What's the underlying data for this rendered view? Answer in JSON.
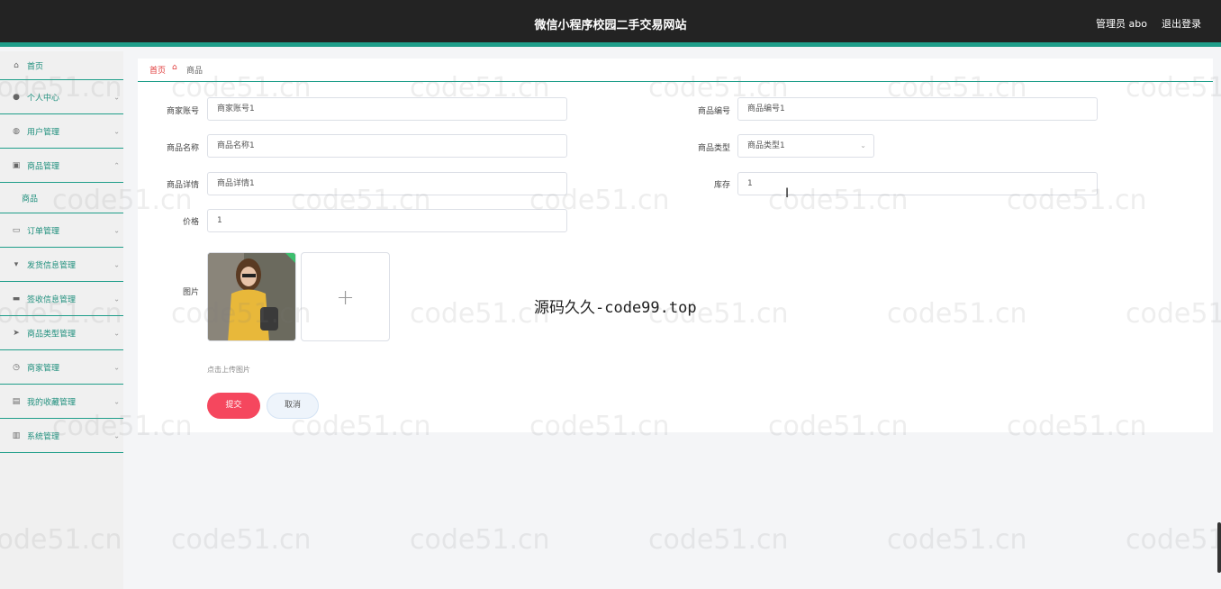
{
  "header": {
    "title": "微信小程序校园二手交易网站",
    "user": "管理员 abo",
    "logout": "退出登录"
  },
  "sidebar": {
    "items": [
      {
        "label": "首页",
        "icon": "home-icon",
        "glyph": "⌂"
      },
      {
        "label": "个人中心",
        "icon": "user-icon",
        "glyph": "●"
      },
      {
        "label": "用户管理",
        "icon": "users-icon",
        "glyph": "◍"
      },
      {
        "label": "商品管理",
        "icon": "goods-icon",
        "glyph": "▣"
      },
      {
        "label": "订单管理",
        "icon": "order-icon",
        "glyph": "▭"
      },
      {
        "label": "发货信息管理",
        "icon": "shipping-icon",
        "glyph": "▾"
      },
      {
        "label": "签收信息管理",
        "icon": "sign-icon",
        "glyph": "▬"
      },
      {
        "label": "商品类型管理",
        "icon": "send-icon",
        "glyph": "➤"
      },
      {
        "label": "商家管理",
        "icon": "clock-icon",
        "glyph": "◷"
      },
      {
        "label": "我的收藏管理",
        "icon": "favorite-icon",
        "glyph": "▤"
      },
      {
        "label": "系统管理",
        "icon": "system-icon",
        "glyph": "▥"
      }
    ],
    "submenu_goods": "商品"
  },
  "breadcrumb": {
    "home": "首页",
    "current": "商品"
  },
  "form": {
    "merchant_account": {
      "label": "商家账号",
      "value": "商家账号1"
    },
    "goods_no": {
      "label": "商品编号",
      "value": "商品编号1"
    },
    "goods_name": {
      "label": "商品名称",
      "value": "商品名称1"
    },
    "goods_type": {
      "label": "商品类型",
      "value": "商品类型1"
    },
    "goods_detail": {
      "label": "商品详情",
      "value": "商品详情1"
    },
    "stock": {
      "label": "库存",
      "value": "1"
    },
    "price": {
      "label": "价格",
      "value": "1"
    },
    "image": {
      "label": "图片",
      "hint": "点击上传图片"
    },
    "submit": "提交",
    "cancel": "取消"
  },
  "watermark": "code51.cn",
  "overlay": "源码久久-code99.top"
}
